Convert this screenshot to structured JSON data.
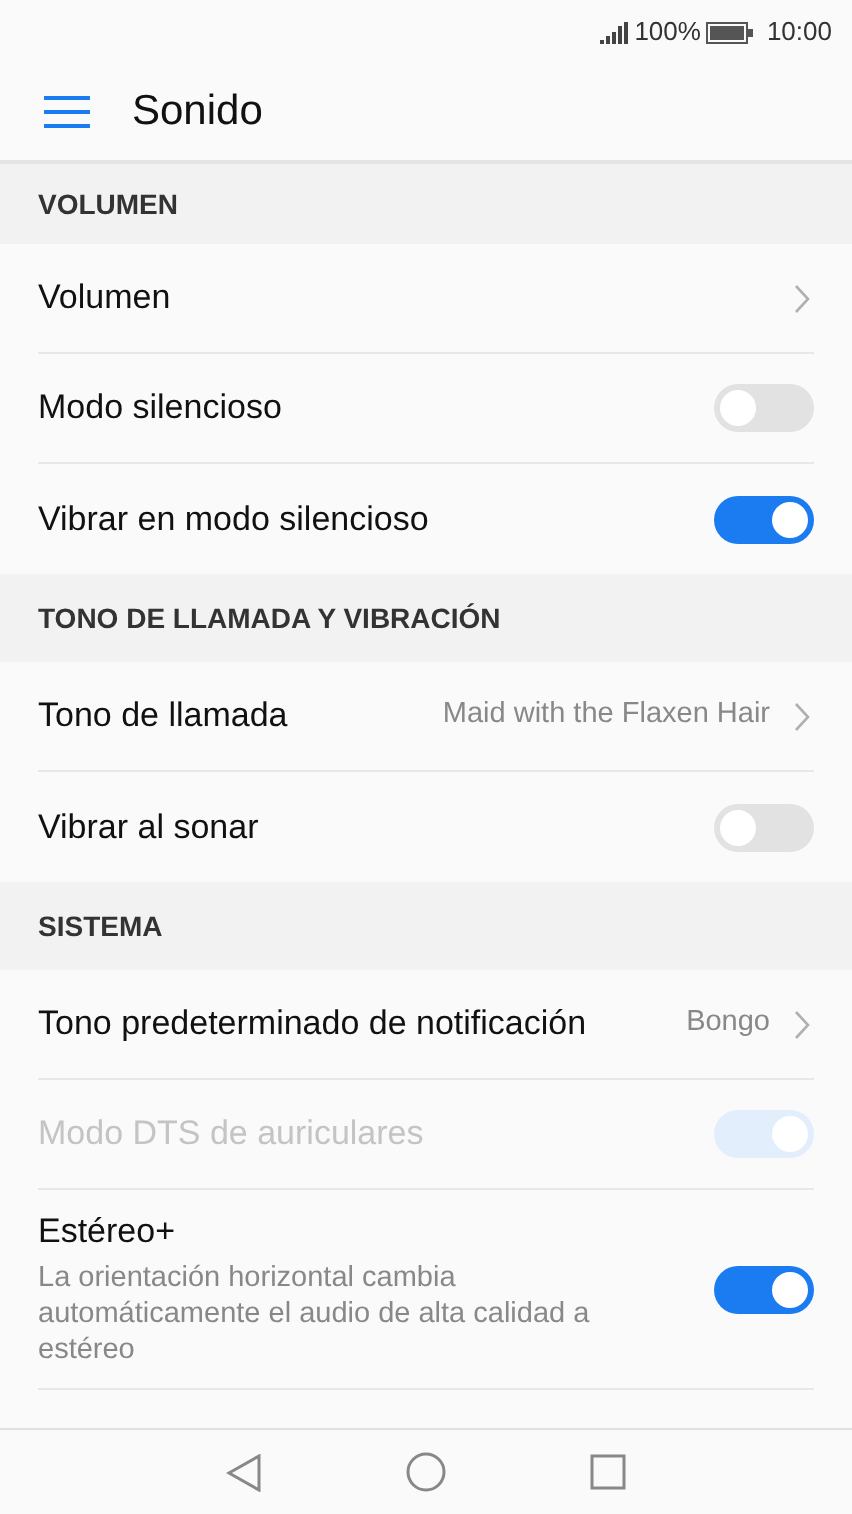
{
  "status_bar": {
    "battery_text": "100%",
    "time": "10:00"
  },
  "app_bar": {
    "title": "Sonido"
  },
  "sections": [
    {
      "header": "VOLUMEN",
      "items": [
        {
          "kind": "link",
          "label": "Volumen"
        },
        {
          "kind": "toggle",
          "label": "Modo silencioso",
          "on": false,
          "disabled": false
        },
        {
          "kind": "toggle",
          "label": "Vibrar en modo silencioso",
          "on": true,
          "disabled": false
        }
      ]
    },
    {
      "header": "TONO DE LLAMADA Y VIBRACIÓN",
      "items": [
        {
          "kind": "link",
          "label": "Tono de llamada",
          "value": "Maid with the Flaxen Hair"
        },
        {
          "kind": "toggle",
          "label": "Vibrar al sonar",
          "on": false,
          "disabled": false
        }
      ]
    },
    {
      "header": "SISTEMA",
      "items": [
        {
          "kind": "link",
          "label": "Tono predeterminado de notificación",
          "value": "Bongo"
        },
        {
          "kind": "toggle",
          "label": "Modo DTS de auriculares",
          "on": true,
          "disabled": true
        },
        {
          "kind": "toggle",
          "label": "Estéreo+",
          "description": "La orientación horizontal cambia automáticamente el audio de alta calidad a estéreo",
          "on": true,
          "disabled": false
        }
      ]
    }
  ]
}
